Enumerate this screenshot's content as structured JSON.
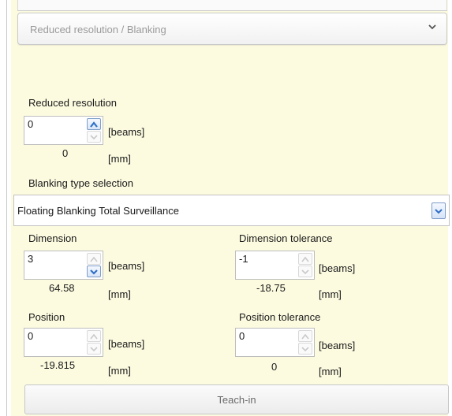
{
  "section": {
    "title": "Reduced resolution / Blanking"
  },
  "reduced_resolution": {
    "label": "Reduced resolution",
    "value": "0",
    "unit_beams": "[beams]",
    "mm_value": "0",
    "unit_mm": "[mm]"
  },
  "blanking": {
    "label": "Blanking type selection",
    "selected": "Floating Blanking Total Surveillance"
  },
  "dimension": {
    "label": "Dimension",
    "value": "3",
    "unit_beams": "[beams]",
    "mm_value": "64.58",
    "unit_mm": "[mm]"
  },
  "dimension_tolerance": {
    "label": "Dimension tolerance",
    "value": "-1",
    "unit_beams": "[beams]",
    "mm_value": "-18.75",
    "unit_mm": "[mm]"
  },
  "position": {
    "label": "Position",
    "value": "0",
    "unit_beams": "[beams]",
    "mm_value": "-19.815",
    "unit_mm": "[mm]"
  },
  "position_tolerance": {
    "label": "Position tolerance",
    "value": "0",
    "unit_beams": "[beams]",
    "mm_value": "0",
    "unit_mm": "[mm]"
  },
  "teach_in": {
    "label": "Teach-in"
  },
  "colors": {
    "panel": "#fcfbe0",
    "accent": "#7c9cc8",
    "arrow_active": "#2f6fc7",
    "arrow_disabled": "#c9c9c9"
  },
  "icons": {
    "header_chevron": "chevron-down-icon",
    "spin_up": "arrow-up-icon",
    "spin_down": "arrow-down-icon"
  }
}
